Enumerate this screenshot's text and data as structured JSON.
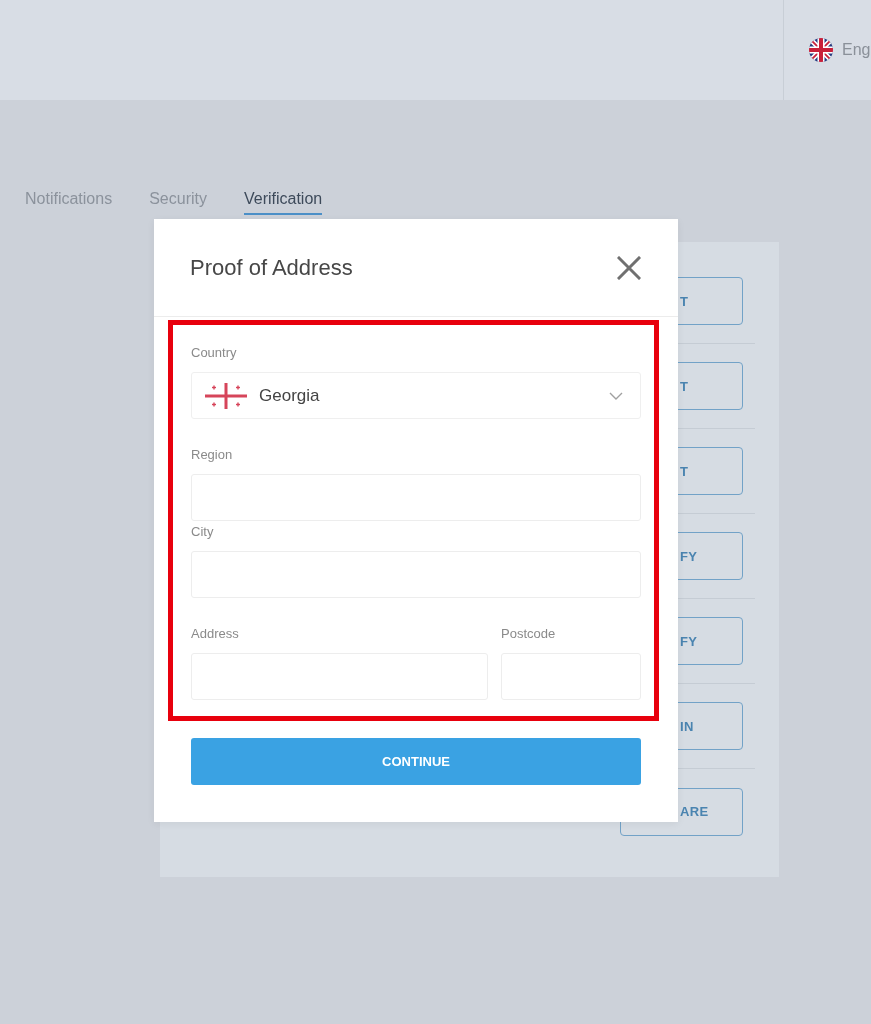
{
  "header": {
    "language": {
      "label": "Eng"
    }
  },
  "tabs": [
    {
      "label": "Notifications",
      "selected": false
    },
    {
      "label": "Security",
      "selected": false
    },
    {
      "label": "Verification",
      "selected": true
    }
  ],
  "actions": [
    {
      "label": "T"
    },
    {
      "label": "T"
    },
    {
      "label": "T"
    },
    {
      "label": "FY"
    },
    {
      "label": "FY"
    },
    {
      "label": "IN"
    },
    {
      "label": "ARE"
    }
  ],
  "dialog": {
    "title": "Proof of Address",
    "rows": [
      {
        "fields": [
          {
            "kind": "select",
            "label": "Country",
            "value": "Georgia"
          }
        ]
      },
      {
        "fields": [
          {
            "kind": "text",
            "label": "Region"
          }
        ]
      },
      {
        "fields": [
          {
            "kind": "text",
            "label": "City"
          }
        ]
      },
      {
        "fields": [
          {
            "kind": "text",
            "label": "Address"
          },
          {
            "kind": "text",
            "label": "Postcode"
          }
        ]
      }
    ],
    "submit": "CONTINUE"
  }
}
